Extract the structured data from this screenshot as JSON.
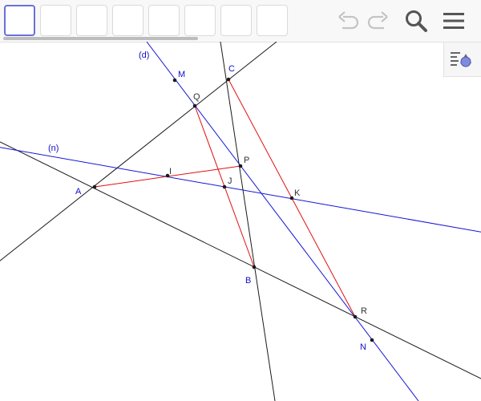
{
  "toolbar": {
    "tools": [
      {
        "name": "move-tool",
        "active": true
      },
      {
        "name": "point-tool",
        "active": false
      },
      {
        "name": "line-tool",
        "active": false
      },
      {
        "name": "perpendicular-tool",
        "active": false
      },
      {
        "name": "polygon-tool",
        "active": false
      },
      {
        "name": "circle-tool",
        "active": false
      },
      {
        "name": "ellipse-tool",
        "active": false
      },
      {
        "name": "angle-tool",
        "active": false
      }
    ],
    "undo_icon": "undo-icon",
    "redo_icon": "redo-icon",
    "search_icon": "search-icon",
    "menu_icon": "menu-icon",
    "style_bar_icon": "style-bar-icon"
  },
  "colors": {
    "black_line": "#1a1a1a",
    "blue_line": "#1515d6",
    "red_segment": "#e01010",
    "point": "#1a1a1a",
    "blue_label": "#1010c8",
    "dark_label": "#333333"
  },
  "labels": {
    "d": "(d)",
    "n": "(n)",
    "M": "M",
    "C": "C",
    "Q": "Q",
    "P": "P",
    "I": "I",
    "J": "J",
    "K": "K",
    "A": "A",
    "B": "B",
    "R": "R",
    "N": "N"
  }
}
